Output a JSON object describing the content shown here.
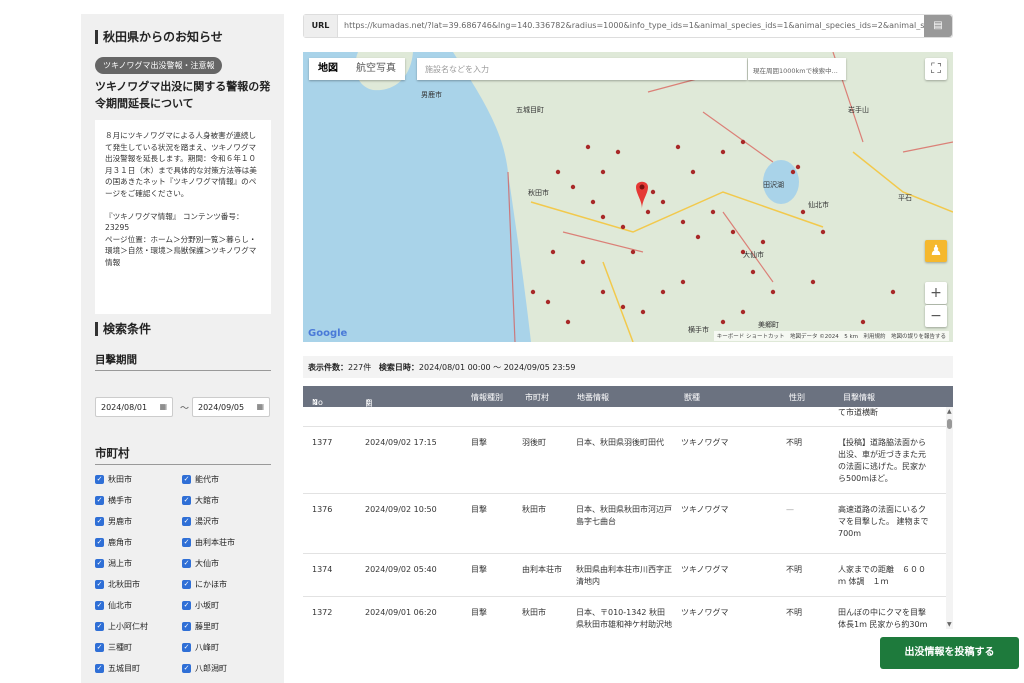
{
  "sidebar": {
    "notice_heading": "秋田県からのお知らせ",
    "tag": "ツキノワグマ出没警報・注意報",
    "notice_title": "ツキノワグマ出没に関する警報の発令期間延長について",
    "notice_p1": "８月にツキノワグマによる人身被害が連続して発生している状況を踏まえ、ツキノワグマ出没警報を延長します。期間：令和６年１０月３１日（木）まで具体的な対策方法等は美の国あきたネット『ツキノワグマ情報』のページをご確認ください。",
    "notice_p2": "『ツキノワグマ情報』 コンテンツ番号：23295",
    "notice_p3": "ページ位置：ホーム＞分野別一覧＞暮らし・環境＞自然・環境＞鳥獣保護＞ツキノワグマ情報",
    "search_heading": "検索条件",
    "period_heading": "目撃期間",
    "date_from": "2024/08/01",
    "date_to": "2024/09/05",
    "tilde": "〜",
    "municipality_heading": "市町村",
    "municipalities": [
      "秋田市",
      "能代市",
      "横手市",
      "大館市",
      "男鹿市",
      "湯沢市",
      "鹿角市",
      "由利本荘市",
      "潟上市",
      "大仙市",
      "北秋田市",
      "にかほ市",
      "仙北市",
      "小坂町",
      "上小阿仁村",
      "藤里町",
      "三種町",
      "八峰町",
      "五城目町",
      "八郎潟町"
    ]
  },
  "url": {
    "label": "URL",
    "value": "https://kumadas.net/?lat=39.686746&lng=140.336782&radius=1000&info_type_ids=1&animal_species_ids=1&animal_species_ids=2&animal_species_ids=",
    "copy_icon": "clipboard-icon"
  },
  "map": {
    "tab_map": "地図",
    "tab_aerial": "航空写真",
    "search_placeholder": "施設名などを入力",
    "radius_button": "現在周囲1000kmで検索中...",
    "labels": [
      "秋田市",
      "男鹿市",
      "五城目町",
      "田沢湖",
      "仙北市",
      "大仙市",
      "美郷町",
      "横手市",
      "岩手山",
      "平石"
    ],
    "google": "Google",
    "footer": "キーボード ショートカット　地図データ ©2024　5 km　利用規約　地図の誤りを報告する"
  },
  "summary": {
    "count_label": "表示件数：",
    "count": "227件",
    "period_label": "検索日時：",
    "period": "2024/08/01 00:00 〜 2024/09/05 23:59"
  },
  "table": {
    "headers": [
      "No",
      "目撃日時",
      "情報種別",
      "市町村",
      "地番情報",
      "獣種",
      "性別",
      "目撃情報"
    ],
    "partial_top": "て市道横断",
    "rows": [
      {
        "no": "1377",
        "date": "2024/09/02 17:15",
        "type": "目撃",
        "city": "羽後町",
        "address": "日本、秋田県羽後町田代",
        "species": "ツキノワグマ",
        "sex": "不明",
        "info": "【投稿】道路脇法面から出没、車が近づきまた元の法面に逃げた。民家から500mほど。"
      },
      {
        "no": "1376",
        "date": "2024/09/02 10:50",
        "type": "目撃",
        "city": "秋田市",
        "address": "日本、秋田県秋田市河辺戸島字七曲台",
        "species": "ツキノワグマ",
        "sex": "—",
        "info": "高速道路の法面にいるクマを目撃した。 建物まで700m"
      },
      {
        "no": "1374",
        "date": "2024/09/02 05:40",
        "type": "目撃",
        "city": "由利本荘市",
        "address": "秋田県由利本荘市川西字正清地内",
        "species": "ツキノワグマ",
        "sex": "不明",
        "info": "人家までの距離　６００ｍ 体調　１ｍ"
      },
      {
        "no": "1372",
        "date": "2024/09/01 06:20",
        "type": "目撃",
        "city": "秋田市",
        "address": "日本、〒010-1342 秋田県秋田市雄和神ケ村助沢地内",
        "species": "ツキノワグマ",
        "sex": "不明",
        "info": "田んぼの中にクマを目撃 体長1m 民家から約30m"
      }
    ]
  },
  "post_button": "出没情報を投稿する",
  "colors": {
    "accent_green": "#1e7a3c",
    "checkbox_blue": "#2f6fd6",
    "table_header": "#6b7280",
    "marker_red": "#a82828"
  }
}
